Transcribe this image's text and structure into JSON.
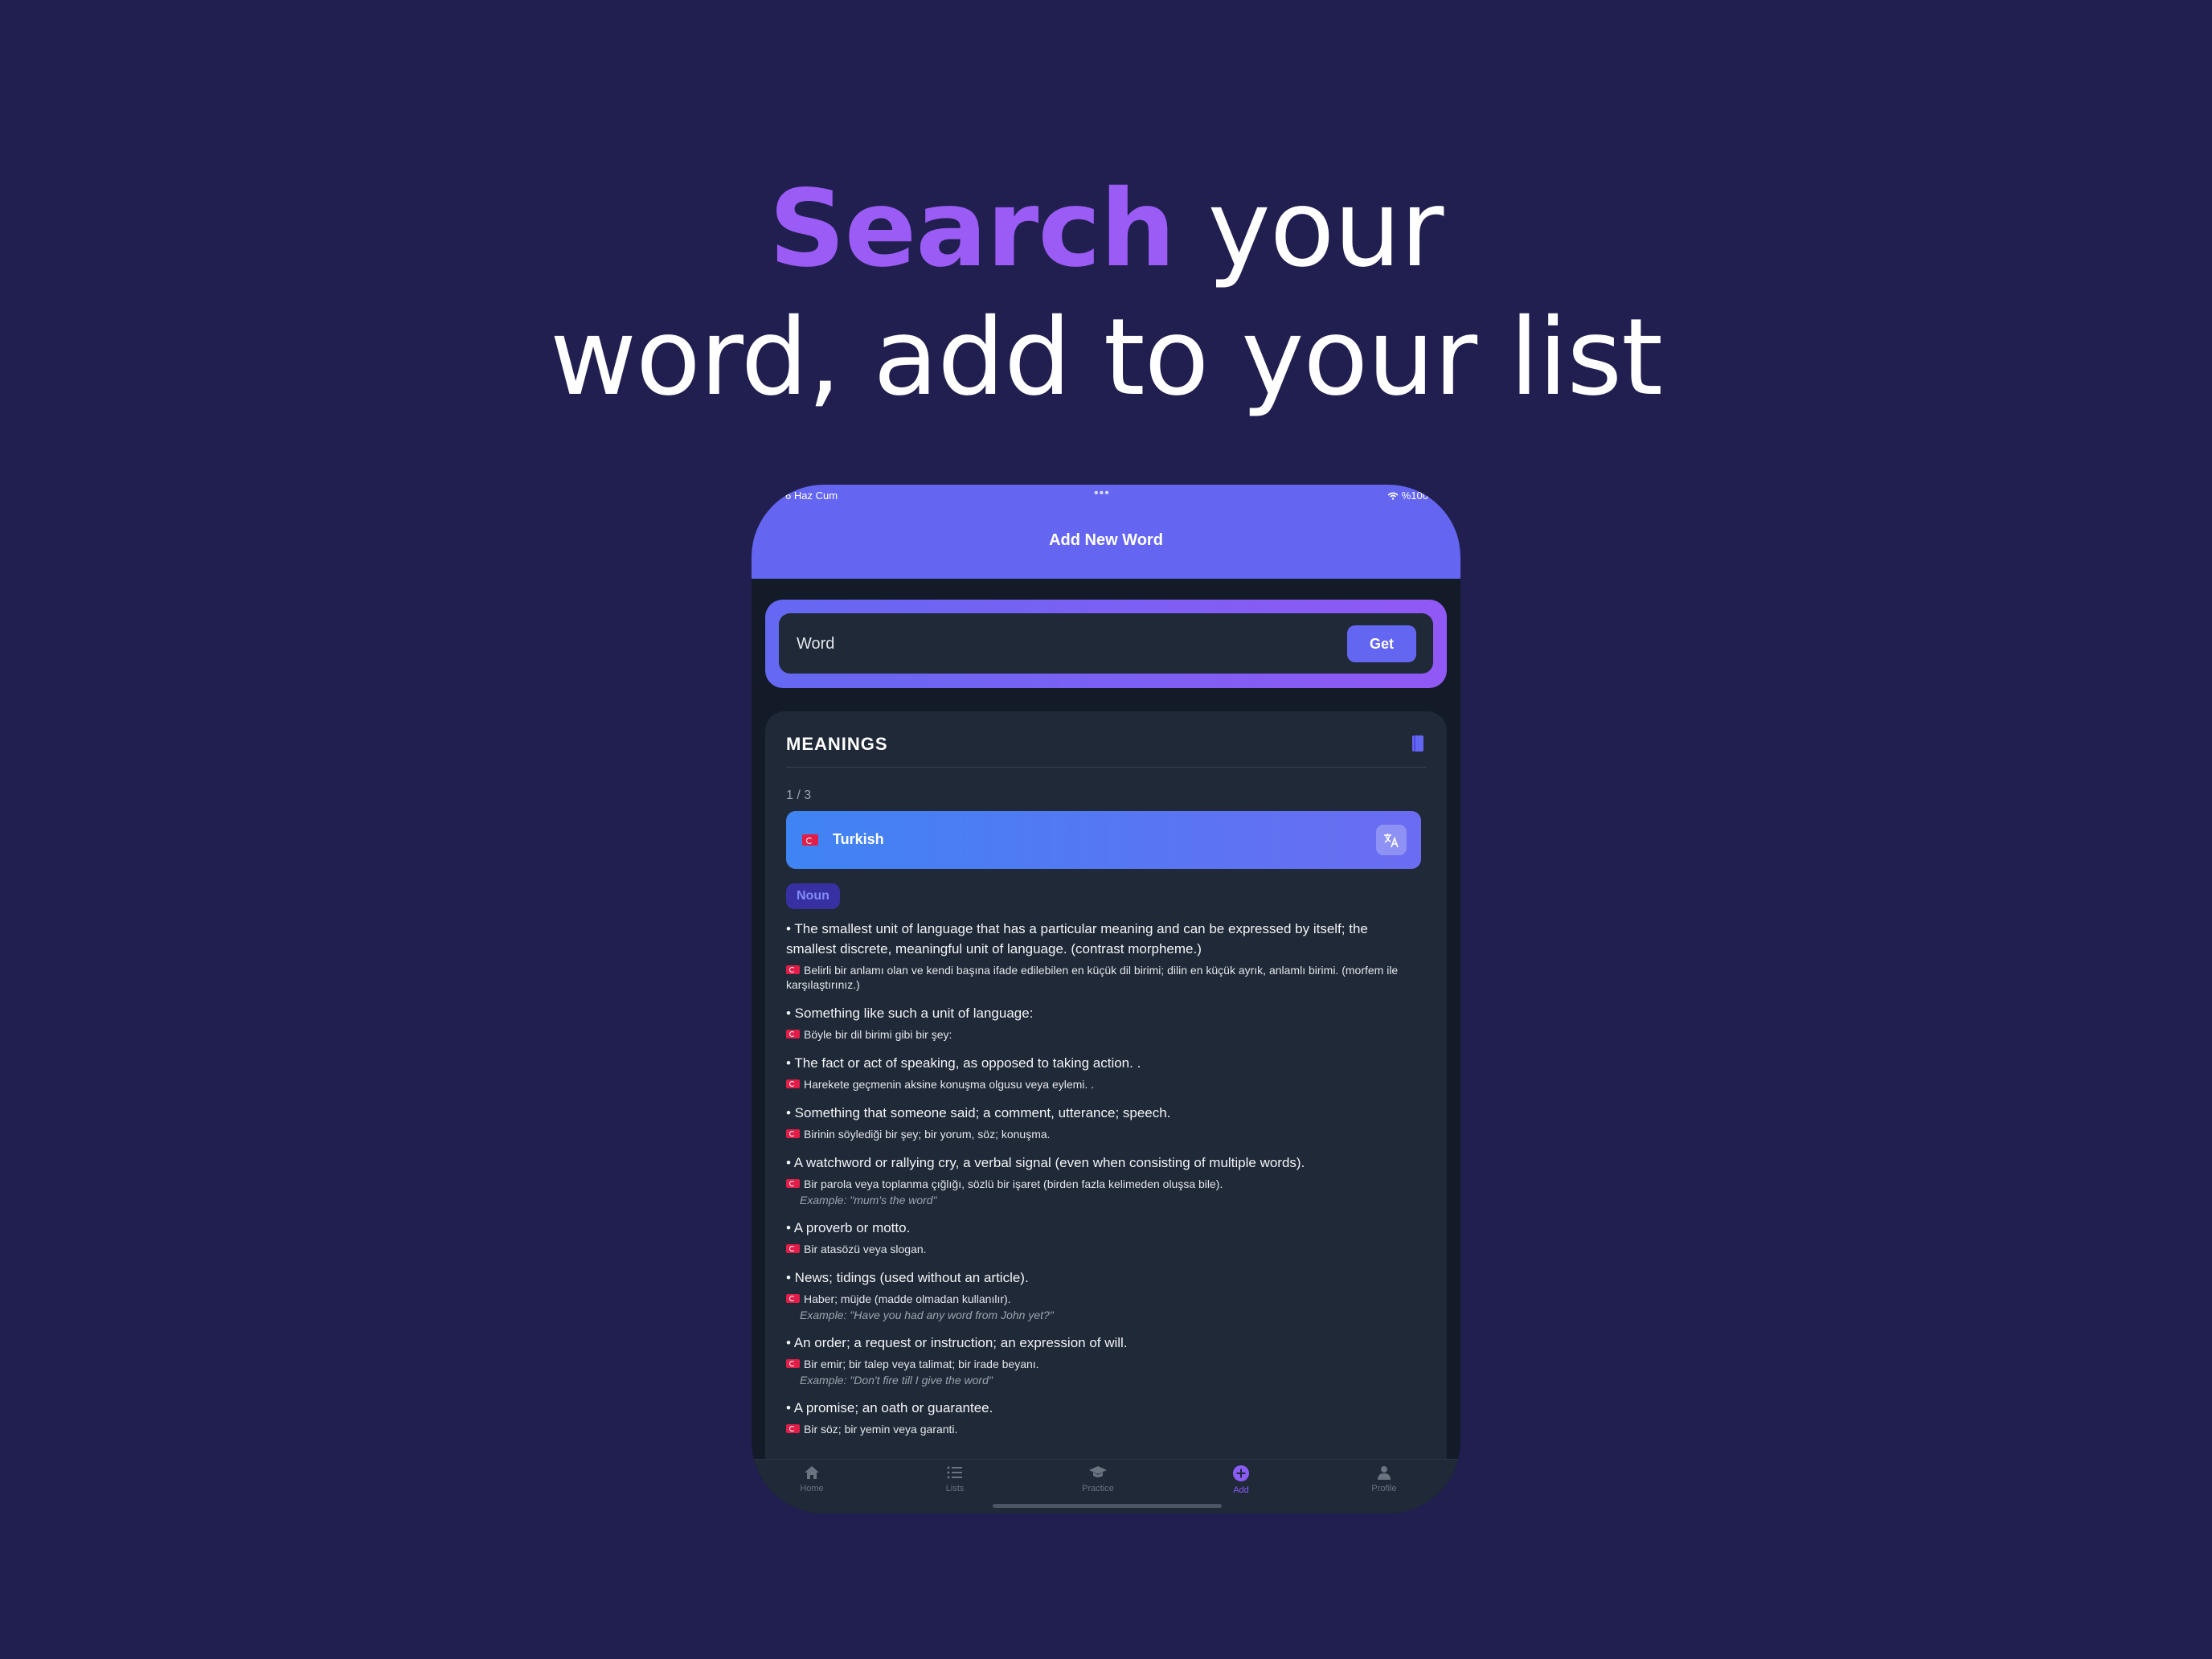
{
  "headline": {
    "accent": "Search",
    "rest_line1": " your",
    "line2": "word, add to your list"
  },
  "colors": {
    "background": "#211f4f",
    "accent": "#9b5cf6",
    "header": "#6466f1",
    "card": "#1f2937"
  },
  "status_bar": {
    "left": "6 Haz Cum",
    "right": "%100"
  },
  "header": {
    "title": "Add New Word"
  },
  "search": {
    "placeholder": "Word",
    "button_label": "Get"
  },
  "meanings_card": {
    "title": "MEANINGS",
    "counter": "1 / 3",
    "language": "Turkish",
    "part_of_speech": "Noun",
    "items": [
      {
        "definition": "• The smallest unit of language that has a particular meaning and can be expressed by itself; the smallest discrete, meaningful unit of language. (contrast morpheme.)",
        "translation": "Belirli bir anlamı olan ve kendi başına ifade edilebilen en küçük dil birimi; dilin en küçük ayrık, anlamlı birimi. (morfem ile karşılaştırınız.)",
        "example": ""
      },
      {
        "definition": "• Something like such a unit of language:",
        "translation": "Böyle bir dil birimi gibi bir şey:",
        "example": ""
      },
      {
        "definition": "• The fact or act of speaking, as opposed to taking action. .",
        "translation": "Harekete geçmenin aksine konuşma olgusu veya eylemi. .",
        "example": ""
      },
      {
        "definition": "• Something that someone said; a comment, utterance; speech.",
        "translation": "Birinin söylediği bir şey; bir yorum, söz; konuşma.",
        "example": ""
      },
      {
        "definition": "• A watchword or rallying cry, a verbal signal (even when consisting of multiple words).",
        "translation": "Bir parola veya toplanma çığlığı, sözlü bir işaret (birden fazla kelimeden oluşsa bile).",
        "example": "Example: \"mum's the word\""
      },
      {
        "definition": "• A proverb or motto.",
        "translation": "Bir atasözü veya slogan.",
        "example": ""
      },
      {
        "definition": "• News; tidings (used without an article).",
        "translation": "Haber; müjde (madde olmadan kullanılır).",
        "example": "Example: \"Have you had any word from John yet?\""
      },
      {
        "definition": "• An order; a request or instruction; an expression of will.",
        "translation": "Bir emir; bir talep veya talimat; bir irade beyanı.",
        "example": "Example: \"Don't fire till I give the word\""
      },
      {
        "definition": "• A promise; an oath or guarantee.",
        "translation": "Bir söz; bir yemin veya garanti.",
        "example": ""
      }
    ]
  },
  "tabs": [
    {
      "label": "Home",
      "icon": "home-icon",
      "active": false
    },
    {
      "label": "Lists",
      "icon": "list-icon",
      "active": false
    },
    {
      "label": "Practice",
      "icon": "graduation-cap-icon",
      "active": false
    },
    {
      "label": "Add",
      "icon": "plus-circle-icon",
      "active": true
    },
    {
      "label": "Profile",
      "icon": "person-icon",
      "active": false
    }
  ]
}
